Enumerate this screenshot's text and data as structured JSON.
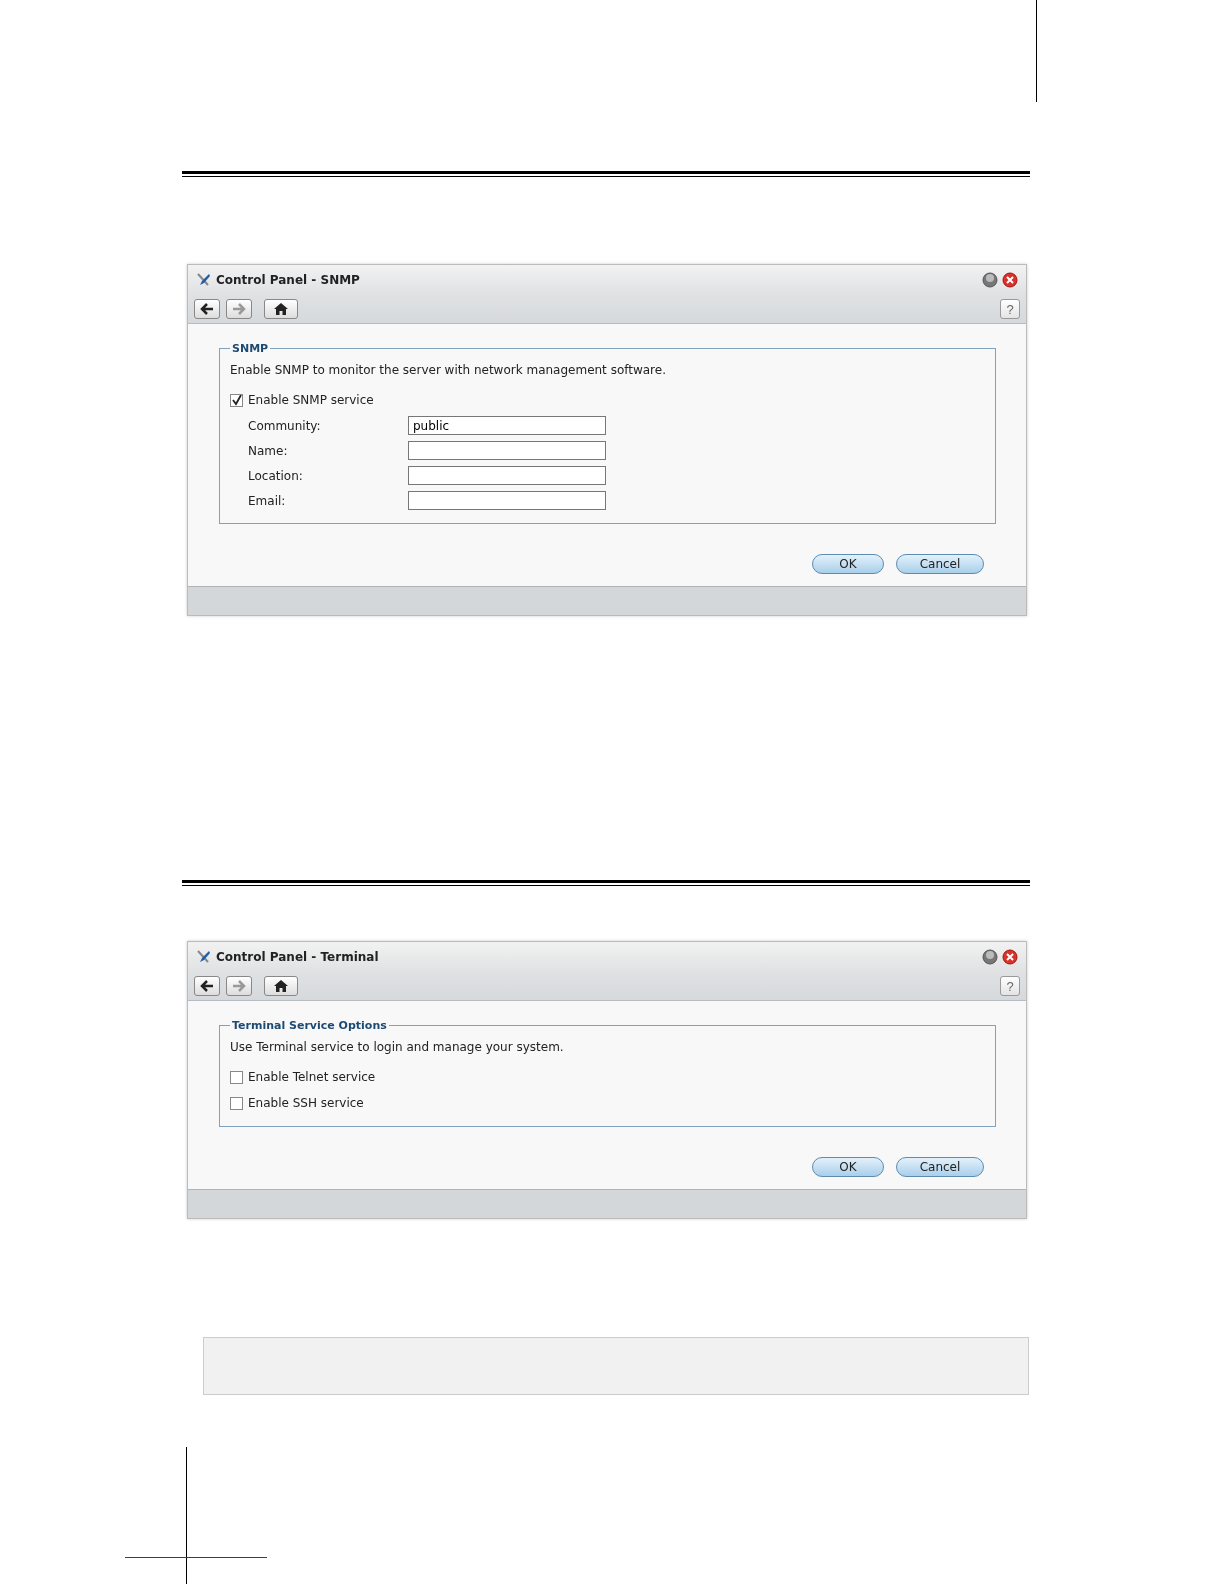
{
  "windows": [
    {
      "title": "Control Panel - SNMP",
      "help": "?",
      "legend": "SNMP",
      "description": "Enable SNMP to monitor the server with network management software.",
      "checkboxes": [
        {
          "label": "Enable SNMP service",
          "checked": true
        }
      ],
      "fields": [
        {
          "label": "Community:",
          "value": "public"
        },
        {
          "label": "Name:"
        },
        {
          "label": "Location:"
        },
        {
          "label": "Email:"
        }
      ],
      "buttons": [
        "OK",
        "Cancel"
      ]
    },
    {
      "title": "Control Panel - Terminal",
      "help": "?",
      "legend": "Terminal Service Options",
      "description": "Use Terminal service to login and manage your system.",
      "checkboxes": [
        {
          "label": "Enable Telnet service",
          "checked": false
        },
        {
          "label": "Enable SSH service",
          "checked": false
        }
      ],
      "buttons": [
        "OK",
        "Cancel"
      ]
    }
  ]
}
